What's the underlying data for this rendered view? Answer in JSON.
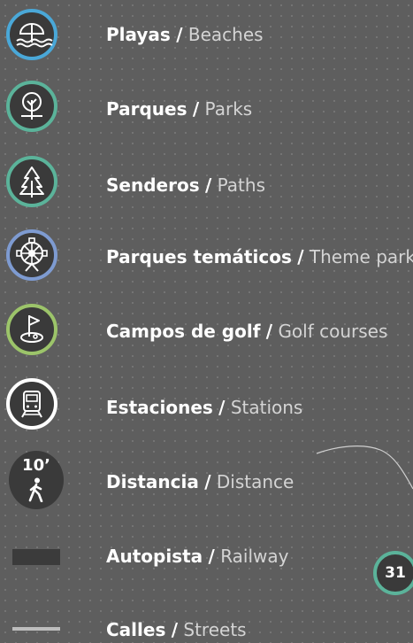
{
  "legend": {
    "items": [
      {
        "es": "Playas",
        "en": "Beaches",
        "icon": "beach-umbrella-icon",
        "ring": "#4aa8d8"
      },
      {
        "es": "Parques",
        "en": "Parks",
        "icon": "tree-icon",
        "ring": "#5bb39a"
      },
      {
        "es": "Senderos",
        "en": "Paths",
        "icon": "pine-tree-icon",
        "ring": "#5bb39a"
      },
      {
        "es": "Parques temáticos",
        "en": "Theme parks",
        "icon": "ferris-wheel-icon",
        "ring": "#7e9bd1"
      },
      {
        "es": "Campos de golf",
        "en": "Golf courses",
        "icon": "golf-flag-icon",
        "ring": "#9cc46a"
      },
      {
        "es": "Estaciones",
        "en": "Stations",
        "icon": "train-icon",
        "ring": "#ffffff"
      },
      {
        "es": "Distancia",
        "en": "Distance",
        "icon": "walking-person-icon",
        "distance_value": "10’"
      },
      {
        "es": "Autopista",
        "en": "Railway",
        "swatch": "railway"
      },
      {
        "es": "Calles",
        "en": "Streets",
        "swatch": "street"
      }
    ],
    "separator": "/"
  },
  "page_number": "31",
  "colors": {
    "background": "#5e5e5e",
    "icon_fill": "#3a3a3a",
    "label_primary": "#ffffff",
    "label_secondary": "#d4d4d4"
  }
}
